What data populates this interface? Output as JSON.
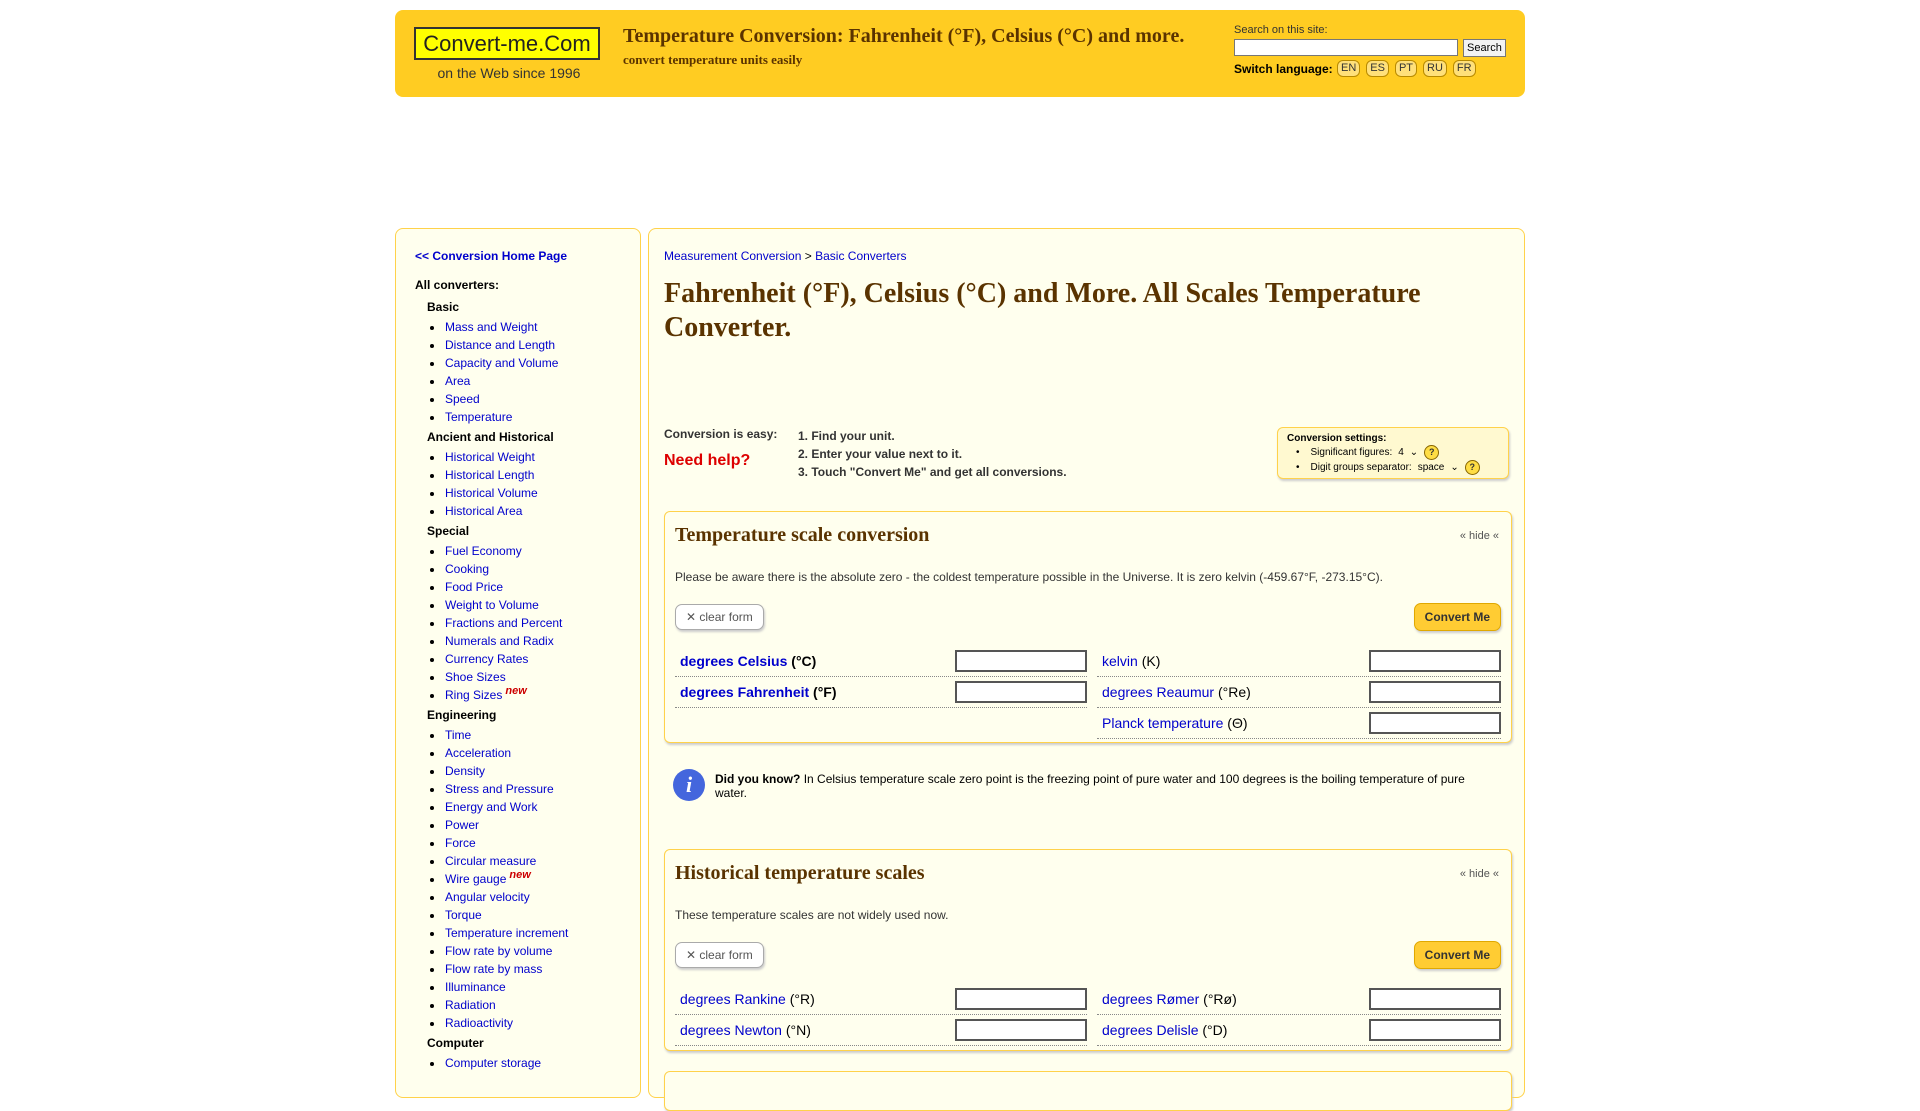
{
  "header": {
    "logo_text": "Convert-me.Com",
    "logo_sub": "on the Web since 1996",
    "title": "Temperature Conversion: Fahrenheit (°F), Celsius (°C) and more.",
    "subtitle": "convert temperature units easily",
    "search_label": "Search on this site:",
    "search_button": "Search",
    "lang_label": "Switch language:",
    "languages": [
      "EN",
      "ES",
      "PT",
      "RU",
      "FR"
    ]
  },
  "sidebar": {
    "home_link": "<< Conversion Home Page",
    "all_label": "All converters:",
    "groups": [
      {
        "title": "Basic",
        "items": [
          {
            "label": "Mass and Weight"
          },
          {
            "label": "Distance and Length"
          },
          {
            "label": "Capacity and Volume"
          },
          {
            "label": "Area"
          },
          {
            "label": "Speed"
          },
          {
            "label": "Temperature"
          }
        ]
      },
      {
        "title": "Ancient and Historical",
        "items": [
          {
            "label": "Historical Weight"
          },
          {
            "label": "Historical Length"
          },
          {
            "label": "Historical Volume"
          },
          {
            "label": "Historical Area"
          }
        ]
      },
      {
        "title": "Special",
        "items": [
          {
            "label": "Fuel Economy"
          },
          {
            "label": "Cooking"
          },
          {
            "label": "Food Price"
          },
          {
            "label": "Weight to Volume"
          },
          {
            "label": "Fractions and Percent"
          },
          {
            "label": "Numerals and Radix"
          },
          {
            "label": "Currency Rates"
          },
          {
            "label": "Shoe Sizes"
          },
          {
            "label": "Ring Sizes",
            "badge": "new"
          }
        ]
      },
      {
        "title": "Engineering",
        "items": [
          {
            "label": "Time"
          },
          {
            "label": "Acceleration"
          },
          {
            "label": "Density"
          },
          {
            "label": "Stress and Pressure"
          },
          {
            "label": "Energy and Work"
          },
          {
            "label": "Power"
          },
          {
            "label": "Force"
          },
          {
            "label": "Circular measure"
          },
          {
            "label": "Wire gauge",
            "badge": "new"
          },
          {
            "label": "Angular velocity"
          },
          {
            "label": "Torque"
          },
          {
            "label": "Temperature increment"
          },
          {
            "label": "Flow rate by volume"
          },
          {
            "label": "Flow rate by mass"
          },
          {
            "label": "Illuminance"
          },
          {
            "label": "Radiation"
          },
          {
            "label": "Radioactivity"
          }
        ]
      },
      {
        "title": "Computer",
        "items": [
          {
            "label": "Computer storage"
          }
        ]
      }
    ]
  },
  "main": {
    "breadcrumb": {
      "link1": "Measurement Conversion",
      "sep": ">",
      "link2": "Basic Converters"
    },
    "title": "Fahrenheit (°F), Celsius (°C) and More. All Scales Temperature Converter.",
    "easy_label": "Conversion is easy:",
    "need_help": "Need help?",
    "steps": [
      "1. Find your unit.",
      "2. Enter your value next to it.",
      "3. Touch \"Convert Me\" and get all conversions."
    ],
    "settings": {
      "title": "Conversion settings:",
      "sig_label": "Significant figures:",
      "sig_value": "4",
      "sep_label": "Digit groups separator:",
      "sep_value": "space",
      "help": "?"
    },
    "panel1": {
      "title": "Temperature scale conversion",
      "hide": "« hide «",
      "note": "Please be aware there is the absolute zero - the coldest temperature possible in the Universe. It is zero kelvin (-459.67°F, -273.15°C).",
      "clear": "✕ clear form",
      "convert": "Convert Me",
      "units": [
        {
          "name": "degrees Celsius",
          "sym": "(°C)"
        },
        {
          "name": "degrees Fahrenheit",
          "sym": "(°F)"
        },
        {
          "name": "kelvin",
          "sym": "(K)"
        },
        {
          "name": "degrees Reaumur",
          "sym": "(°Re)"
        },
        {
          "name": "Planck temperature",
          "sym": "(Θ)"
        }
      ]
    },
    "info": {
      "lead": "Did you know?",
      "text": "In Celsius temperature scale zero point is the freezing point of pure water and 100 degrees is the boiling temperature of pure water."
    },
    "panel2": {
      "title": "Historical temperature scales",
      "hide": "« hide «",
      "note": "These temperature scales are not widely used now.",
      "clear": "✕ clear form",
      "convert": "Convert Me",
      "units": [
        {
          "name": "degrees Rankine",
          "sym": "(°R)"
        },
        {
          "name": "degrees Newton",
          "sym": "(°N)"
        },
        {
          "name": "degrees Rømer",
          "sym": "(°Rø)"
        },
        {
          "name": "degrees Delisle",
          "sym": "(°D)"
        }
      ]
    }
  }
}
